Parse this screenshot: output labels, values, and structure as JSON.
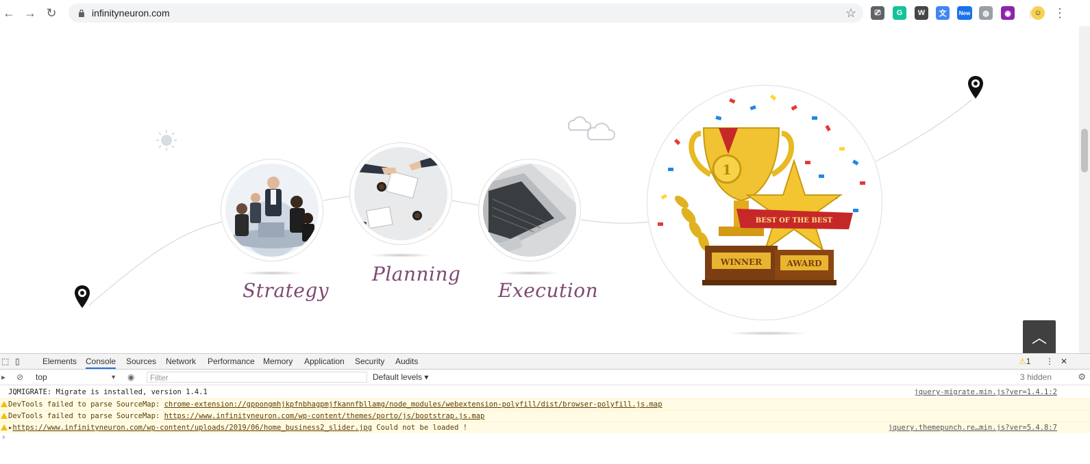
{
  "browser": {
    "url": "infinityneuron.com",
    "back_icon": "arrow-left-icon",
    "forward_icon": "arrow-right-icon",
    "reload_icon": "reload-icon",
    "extensions": [
      {
        "name": "cast-icon",
        "color": "#5f6368",
        "glyph": "⎚"
      },
      {
        "name": "grammarly-icon",
        "color": "#15c39a",
        "glyph": "G"
      },
      {
        "name": "wordpress-icon",
        "color": "#464646",
        "glyph": "W"
      },
      {
        "name": "translate-icon",
        "color": "#4285f4",
        "glyph": "文"
      },
      {
        "name": "new-extension-icon",
        "color": "#1a73e8",
        "glyph": "New"
      },
      {
        "name": "globe-icon",
        "color": "#9aa0a6",
        "glyph": "◍"
      },
      {
        "name": "colorpicker-icon",
        "color": "#8e24aa",
        "glyph": "◉"
      }
    ],
    "colors": {
      "label": "#7d4a72"
    }
  },
  "page": {
    "steps": [
      {
        "label": "Strategy"
      },
      {
        "label": "Planning"
      },
      {
        "label": "Execution"
      }
    ],
    "trophy": {
      "banner_text": "BEST OF THE BEST",
      "plaque_left": "WINNER",
      "plaque_right": "AWARD",
      "medal_number": "1"
    },
    "back_to_top_icon": "chevron-up-icon"
  },
  "devtools": {
    "tabs": [
      {
        "label": "Elements",
        "active": false
      },
      {
        "label": "Console",
        "active": true
      },
      {
        "label": "Sources",
        "active": false
      },
      {
        "label": "Network",
        "active": false
      },
      {
        "label": "Performance",
        "active": false
      },
      {
        "label": "Memory",
        "active": false
      },
      {
        "label": "Application",
        "active": false
      },
      {
        "label": "Security",
        "active": false
      },
      {
        "label": "Audits",
        "active": false
      }
    ],
    "warning_count": "1",
    "context": "top",
    "filter_placeholder": "Filter",
    "levels": "Default levels ▾",
    "hidden": "3 hidden",
    "logs": [
      {
        "type": "info",
        "message": "JQMIGRATE: Migrate is installed, version 1.4.1",
        "link": "",
        "source": "jquery-migrate.min.js?ver=1.4.1:2"
      },
      {
        "type": "warn",
        "message": "DevTools failed to parse SourceMap: ",
        "link": "chrome-extension://gppongmhjkpfnbhagpmjfkannfbllamg/node_modules/webextension-polyfill/dist/browser-polyfill.js.map",
        "source": ""
      },
      {
        "type": "warn",
        "message": "DevTools failed to parse SourceMap: ",
        "link": "https://www.infinityneuron.com/wp-content/themes/porto/js/bootstrap.js.map",
        "source": ""
      },
      {
        "type": "warn",
        "message": "▸",
        "link": "https://www.infinityneuron.com/wp-content/uploads/2019/06/home_business2_slider.jpg",
        "suffix": "  Could not be loaded !",
        "source": "jquery.themepunch.re…min.js?ver=5.4.8:7"
      }
    ]
  }
}
